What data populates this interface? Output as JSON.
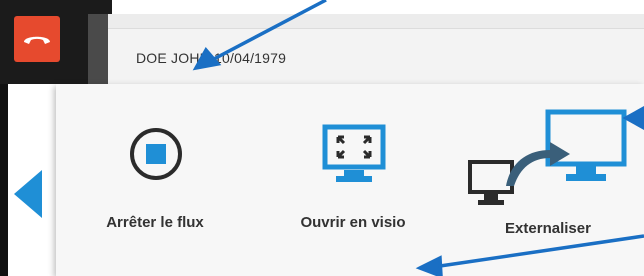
{
  "call": {
    "hangup_label": ""
  },
  "patient": {
    "name": "DOE JOHN",
    "birthdate": "10/04/1979"
  },
  "actions": [
    {
      "label": "Arrêter le flux",
      "icon": "stop-icon"
    },
    {
      "label": "Ouvrir en visio",
      "icon": "fullscreen-monitor-icon"
    },
    {
      "label": "Externaliser",
      "icon": "external-display-icon"
    }
  ],
  "colors": {
    "accent": "#1f8fd6",
    "hangup": "#e64a2e",
    "annotation": "#1a6fc4"
  }
}
